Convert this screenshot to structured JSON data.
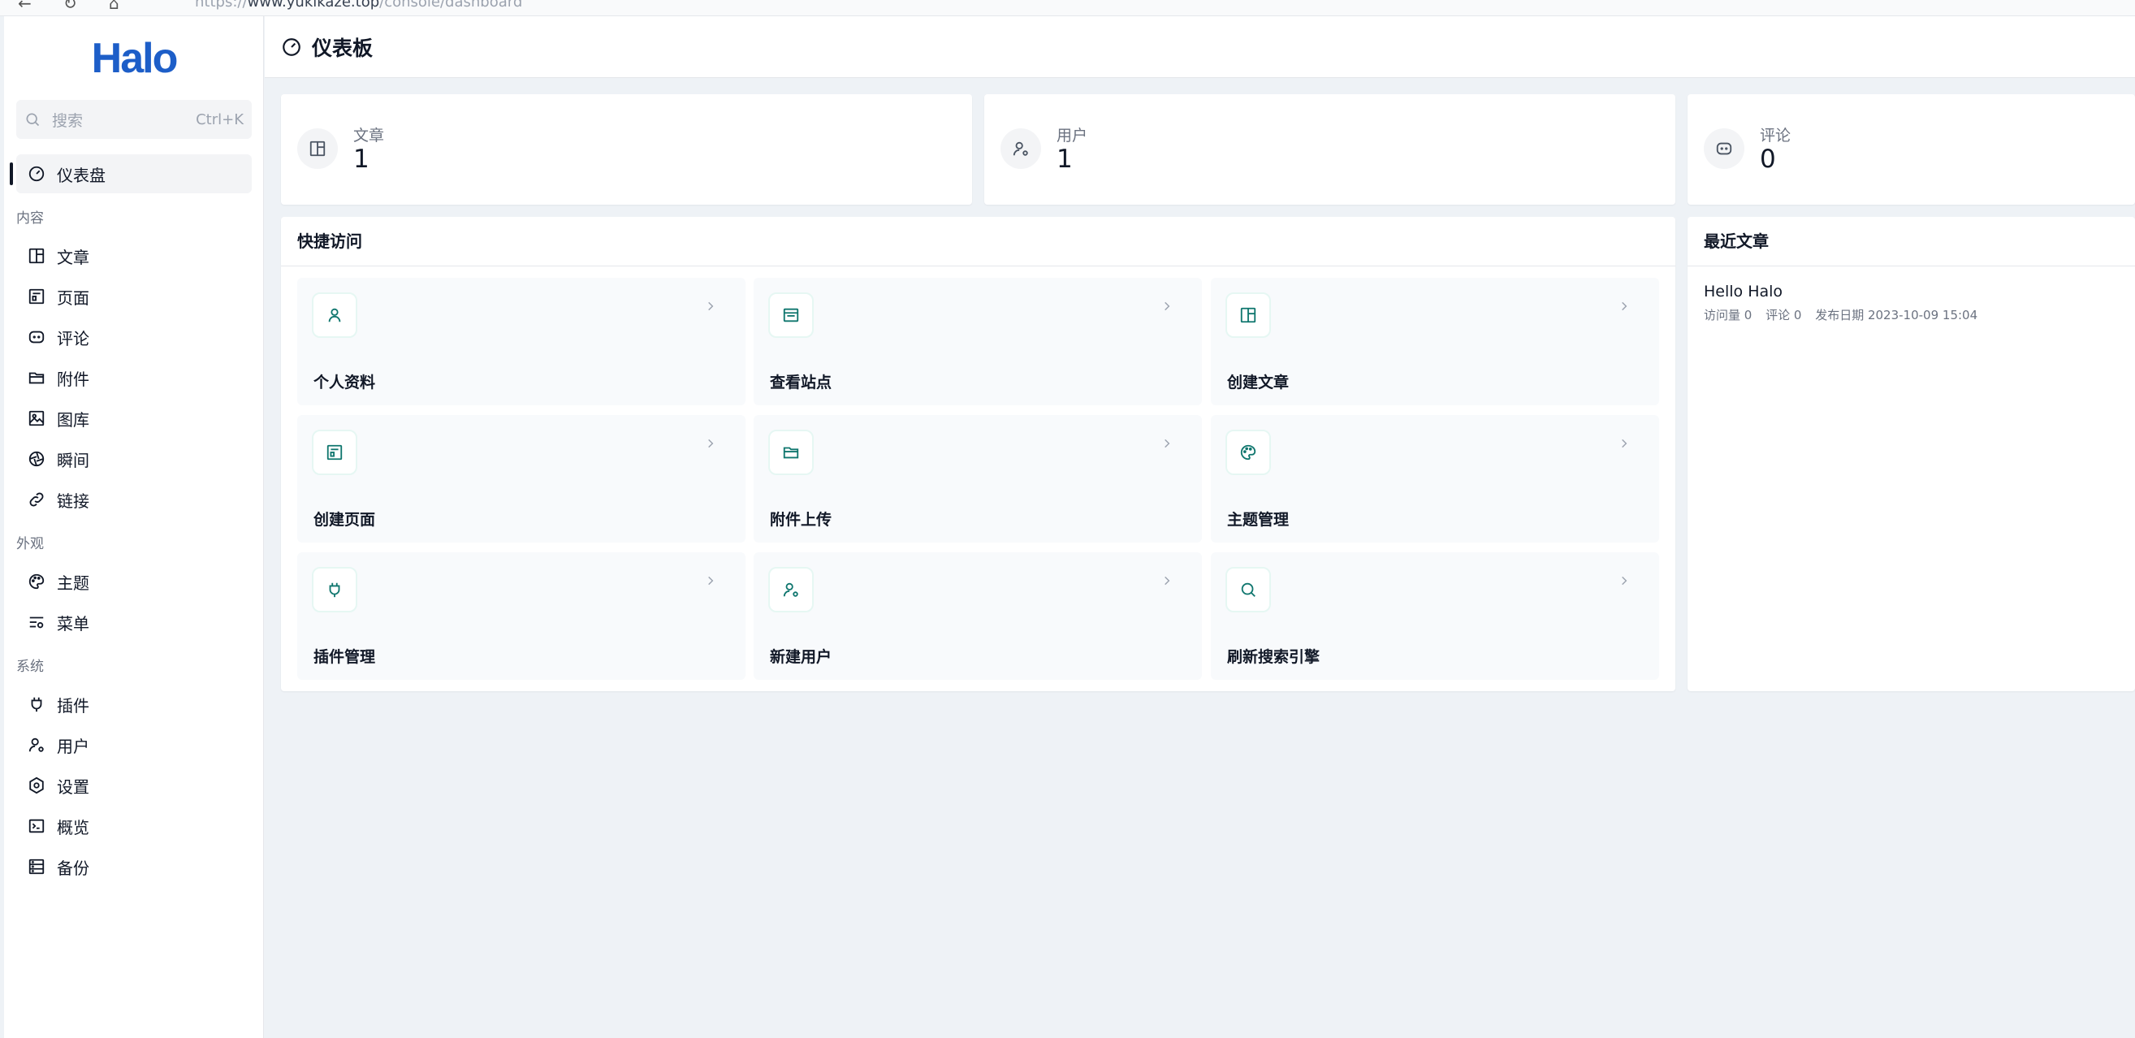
{
  "browser": {
    "url_prefix": "https://",
    "url_host": "www.yukikaze.top",
    "url_path": "/console/dashboard"
  },
  "sidebar": {
    "logo": "Halo",
    "search_placeholder": "搜索",
    "search_shortcut": "Ctrl+K",
    "dashboard": "仪表盘",
    "groups": {
      "content": "内容",
      "appearance": "外观",
      "system": "系统"
    },
    "items": {
      "posts": "文章",
      "pages": "页面",
      "comments": "评论",
      "attachments": "附件",
      "photos": "图库",
      "moments": "瞬间",
      "links": "链接",
      "themes": "主题",
      "menus": "菜单",
      "plugins": "插件",
      "users": "用户",
      "settings": "设置",
      "overview": "概览",
      "backup": "备份"
    }
  },
  "header": {
    "title": "仪表板"
  },
  "stats": [
    {
      "label": "文章",
      "value": "1",
      "icon": "post-icon"
    },
    {
      "label": "用户",
      "value": "1",
      "icon": "user-icon"
    },
    {
      "label": "评论",
      "value": "0",
      "icon": "comment-icon"
    }
  ],
  "quick_access": {
    "title": "快捷访问",
    "items": [
      {
        "label": "个人资料",
        "icon": "user-icon"
      },
      {
        "label": "查看站点",
        "icon": "browser-icon"
      },
      {
        "label": "创建文章",
        "icon": "post-icon"
      },
      {
        "label": "创建页面",
        "icon": "page-icon"
      },
      {
        "label": "附件上传",
        "icon": "folder-icon"
      },
      {
        "label": "主题管理",
        "icon": "palette-icon"
      },
      {
        "label": "插件管理",
        "icon": "plug-icon"
      },
      {
        "label": "新建用户",
        "icon": "user-gear-icon"
      },
      {
        "label": "刷新搜索引擎",
        "icon": "search-icon"
      }
    ]
  },
  "recent_posts": {
    "title": "最近文章",
    "posts": [
      {
        "title": "Hello Halo",
        "visits": "访问量 0",
        "comments": "评论 0",
        "published": "发布日期 2023-10-09 15:04"
      }
    ]
  },
  "colors": {
    "accent": "#0f766e",
    "logo": "#1d5ec8",
    "background": "#eef2f6"
  }
}
